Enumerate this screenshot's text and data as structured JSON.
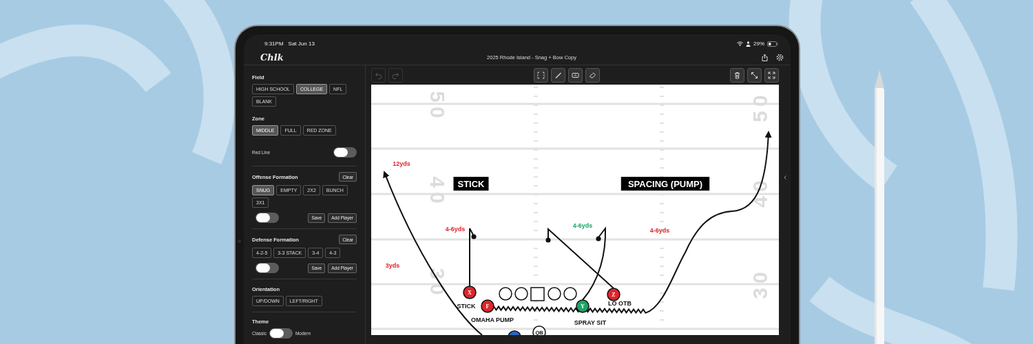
{
  "status_bar": {
    "time": "9:31PM",
    "date": "Sat Jun 13",
    "battery": "29%"
  },
  "header": {
    "logo": "Chlk",
    "title": "2025 Rhode Island - Snag + Bow Copy"
  },
  "toolbar": {
    "undo": {
      "disabled": true
    },
    "redo": {
      "disabled": true
    }
  },
  "sidebar": {
    "sections": [
      {
        "kind": "options",
        "heading": "Field",
        "options": [
          {
            "label": "HIGH SCHOOL",
            "selected": false
          },
          {
            "label": "COLLEGE",
            "selected": true
          },
          {
            "label": "NFL",
            "selected": false
          },
          {
            "label": "BLANK",
            "selected": false
          }
        ]
      },
      {
        "kind": "options",
        "heading": "Zone",
        "options": [
          {
            "label": "MIDDLE",
            "selected": true
          },
          {
            "label": "FULL",
            "selected": false
          },
          {
            "label": "RED ZONE",
            "selected": false
          }
        ]
      },
      {
        "kind": "toggle",
        "label": "Red Line",
        "on": false
      },
      {
        "kind": "formation",
        "heading": "Offense Formation",
        "clear": "Clear",
        "options": [
          {
            "label": "SNUG",
            "selected": true
          },
          {
            "label": "EMPTY",
            "selected": false
          },
          {
            "label": "2X2",
            "selected": false
          },
          {
            "label": "BUNCH",
            "selected": false
          },
          {
            "label": "3X1",
            "selected": false
          }
        ],
        "toggle_on": false,
        "save": "Save",
        "add": "Add Player"
      },
      {
        "kind": "formation",
        "heading": "Defense Formation",
        "clear": "Clear",
        "options": [
          {
            "label": "4-2-5",
            "selected": false
          },
          {
            "label": "3-3 STACK",
            "selected": false
          },
          {
            "label": "3-4",
            "selected": false
          },
          {
            "label": "4-3",
            "selected": false
          }
        ],
        "toggle_on": false,
        "save": "Save",
        "add": "Add Player"
      },
      {
        "kind": "options",
        "heading": "Orientation",
        "options": [
          {
            "label": "UP/DOWN",
            "selected": false
          },
          {
            "label": "LEFT/RIGHT",
            "selected": false
          }
        ]
      },
      {
        "kind": "theme",
        "heading": "Theme",
        "left": "Classic",
        "right": "Modern",
        "on": false
      }
    ]
  },
  "field": {
    "yard_numbers": [
      "50",
      "40",
      "30",
      "50",
      "40",
      "30"
    ],
    "play_labels": [
      "STICK",
      "SPACING (PUMP)"
    ],
    "distance_notes": [
      {
        "text": "12yds",
        "color": "#e0242b"
      },
      {
        "text": "4-6yds",
        "color": "#e0242b"
      },
      {
        "text": "4-6yds",
        "color": "#1aa564"
      },
      {
        "text": "4-6yds",
        "color": "#e0242b"
      },
      {
        "text": "3yds",
        "color": "#e0242b"
      }
    ],
    "players": [
      {
        "letter": "X",
        "color": "#e0242b",
        "route_label": "STICK"
      },
      {
        "letter": "F",
        "color": "#e0242b",
        "route_label": "OMAHA PUMP"
      },
      {
        "letter": "Y",
        "color": "#1aa564",
        "route_label": "SPRAY SIT"
      },
      {
        "letter": "Z",
        "color": "#e0242b",
        "route_label": "LO OTB"
      }
    ],
    "qb": {
      "label": "QB"
    }
  }
}
